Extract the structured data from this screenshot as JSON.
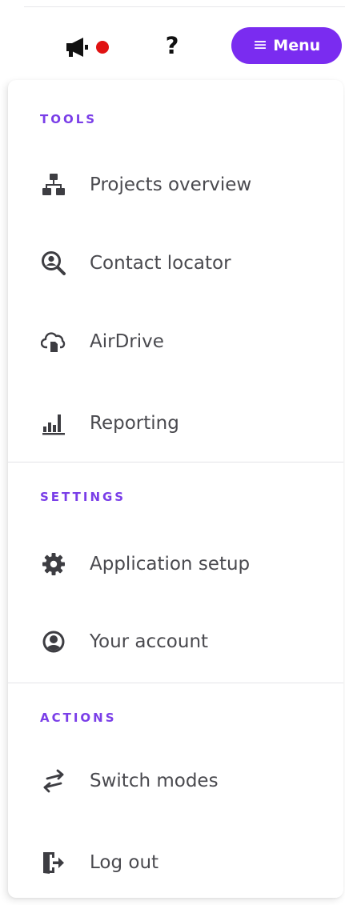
{
  "header": {
    "announcements_icon": "megaphone-icon",
    "notification_color": "#e01212",
    "help_label": "?",
    "menu_icon": "≡",
    "menu_label": "Menu",
    "accent_color": "#7a2cf0"
  },
  "menu": {
    "sections": [
      {
        "title": "TOOLS",
        "items": [
          {
            "label": "Projects overview",
            "icon": "sitemap-icon"
          },
          {
            "label": "Contact locator",
            "icon": "search-user-icon"
          },
          {
            "label": "AirDrive",
            "icon": "cloud-file-icon"
          },
          {
            "label": "Reporting",
            "icon": "bar-chart-icon"
          }
        ]
      },
      {
        "title": "SETTINGS",
        "items": [
          {
            "label": "Application setup",
            "icon": "gear-icon"
          },
          {
            "label": "Your account",
            "icon": "user-circle-icon"
          }
        ]
      },
      {
        "title": "ACTIONS",
        "items": [
          {
            "label": "Switch modes",
            "icon": "swap-arrows-icon"
          },
          {
            "label": "Log out",
            "icon": "logout-door-icon"
          }
        ]
      }
    ]
  }
}
